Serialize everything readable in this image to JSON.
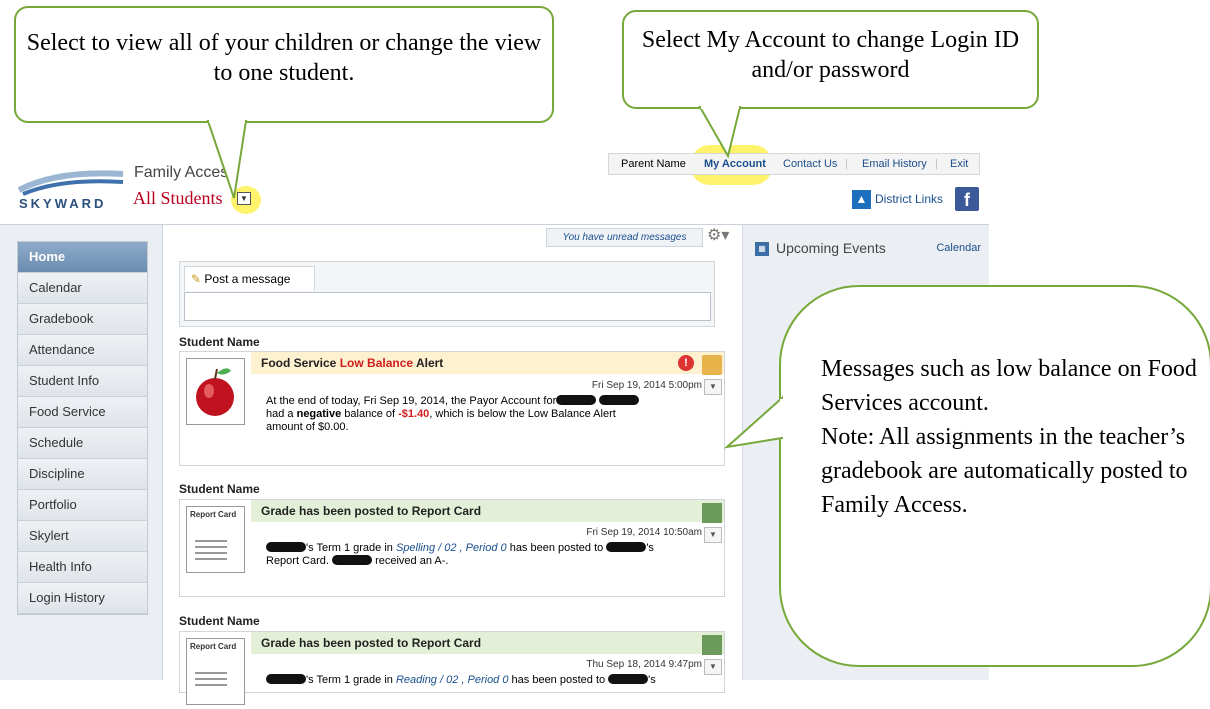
{
  "callouts": {
    "student_view": "Select to view all of your children or change the view to one student.",
    "my_account": "Select My Account to change Login ID and/or password",
    "messages_line1": "Messages such as low balance on Food Services account.",
    "messages_line2": "Note:  All assignments in the teacher’s gradebook are automatically posted to Family Access."
  },
  "brand": {
    "logo_text": "SKYWARD",
    "product": "Family Access",
    "student_selector": "All Students"
  },
  "topbar": {
    "parent_name": "Parent Name",
    "my_account": "My Account",
    "contact_us": "Contact Us",
    "email_history": "Email History",
    "exit": "Exit",
    "district_links": "District Links",
    "facebook": "f"
  },
  "nav": {
    "items": [
      "Home",
      "Calendar",
      "Gradebook",
      "Attendance",
      "Student Info",
      "Food Service",
      "Schedule",
      "Discipline",
      "Portfolio",
      "Skylert",
      "Health Info",
      "Login History"
    ]
  },
  "main": {
    "unread": "You have unread messages",
    "post_tab": "Post a message",
    "cards": [
      {
        "student": "Student Name",
        "title_pre": "Food Service ",
        "title_hl": "Low Balance",
        "title_post": " Alert",
        "date": "Fri Sep 19, 2014 5:00pm",
        "body_1": "At the end of today, Fri Sep 19, 2014, the Payor Account for",
        "body_2": "had a ",
        "body_neg": "negative",
        "body_3": " balance of ",
        "body_amt": "-$1.40",
        "body_4": ", which is below the Low Balance Alert",
        "body_5": "amount of $0.00."
      },
      {
        "student": "Student Name",
        "title": "Grade has been posted to Report Card",
        "date": "Fri Sep 19, 2014 10:50am",
        "body_1": "'s Term 1 grade in ",
        "body_course": "Spelling / 02 , Period 0",
        "body_2": " has been posted to ",
        "body_3": "'s",
        "body_4": "Report Card. ",
        "body_5": " received an A-."
      },
      {
        "student": "Student Name",
        "title": "Grade has been posted to Report Card",
        "date": "Thu Sep 18, 2014 9:47pm",
        "body_1": "'s Term 1 grade in ",
        "body_course": "Reading / 02 , Period 0",
        "body_2": " has been posted to ",
        "body_3": "'s"
      }
    ],
    "report_card_label": "Report Card"
  },
  "right": {
    "upcoming": "Upcoming Events",
    "calendar": "Calendar"
  },
  "colors": {
    "callout_border": "#76a83a",
    "highlight": "#fff36b",
    "alert_header": "#fdf1d0",
    "grade_header": "#e3efd6"
  }
}
